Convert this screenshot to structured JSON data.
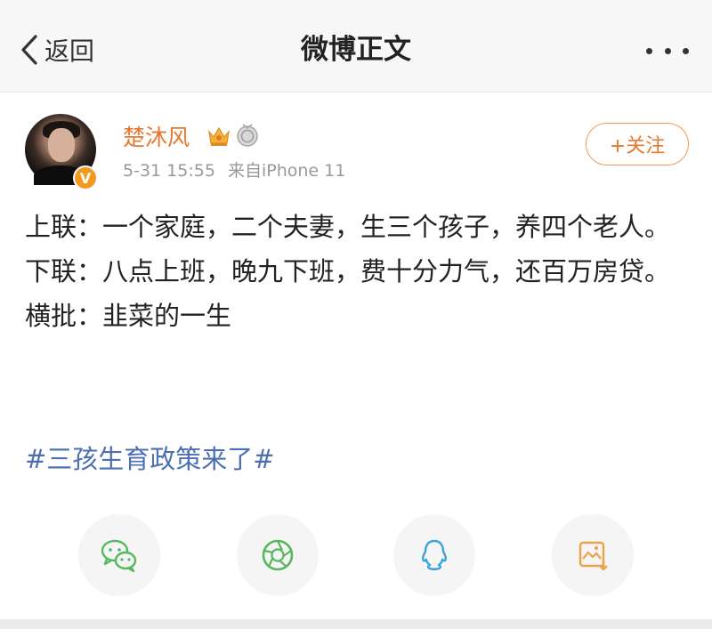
{
  "nav": {
    "back_label": "返回",
    "title": "微博正文"
  },
  "post": {
    "author": "楚沐风",
    "verified_badge": "V",
    "date": "5-31 15:55",
    "source": "来自iPhone 11",
    "follow_label": "+关注",
    "lines": [
      "上联：一个家庭，二个夫妻，生三个孩子，养四个老人。",
      "下联：八点上班，晚九下班，费十分力气，还百万房贷。",
      "横批：韭菜的一生"
    ],
    "hashtag": "#三孩生育政策来了#"
  },
  "share": [
    {
      "name": "wechat",
      "icon": "wechat-icon",
      "color": "#57b85f"
    },
    {
      "name": "moments",
      "icon": "moments-aperture-icon",
      "color": "#57b85f"
    },
    {
      "name": "qq",
      "icon": "qq-penguin-icon",
      "color": "#3aa3d8"
    },
    {
      "name": "save-image",
      "icon": "save-image-icon",
      "color": "#e9a44a"
    }
  ],
  "colors": {
    "username": "#e8772e",
    "hashtag": "#4d6fb3",
    "meta": "#999999",
    "badge": "#f29a1f"
  }
}
